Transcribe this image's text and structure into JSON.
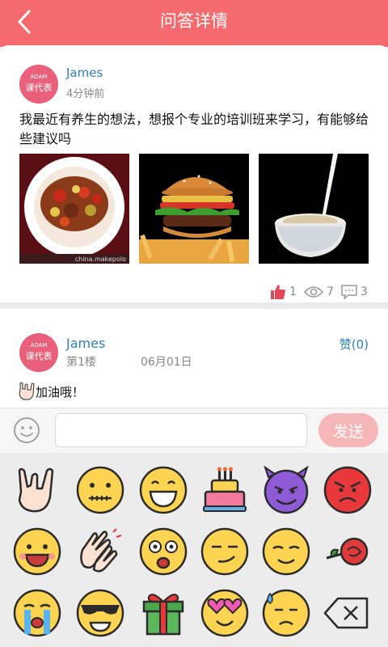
{
  "header": {
    "title": "问答详情",
    "back_icon": "back-arrow-icon"
  },
  "post": {
    "avatar_brand": "ADAM",
    "avatar_text": "课代表",
    "username": "James",
    "time": "4分钟前",
    "text": "我最近有养生的想法，想报个专业的培训班来学习，有能够给些建议吗",
    "photos": [
      "spicy-dish",
      "burger-and-fries",
      "milk-splash"
    ],
    "photo_watermark": "china.makepolo",
    "likes": "1",
    "views": "7",
    "comments": "3"
  },
  "reply": {
    "avatar_brand": "ADAM",
    "avatar_text": "课代表",
    "username": "James",
    "floor": "第1楼",
    "date": "06月01日",
    "like_label": "赞(0)",
    "text": "加油哦！"
  },
  "input": {
    "placeholder": "",
    "send_label": "发送"
  },
  "keyboard": {
    "emojis": [
      "rock-hand",
      "zipper-mouth",
      "grinning",
      "birthday-cake",
      "purple-devil",
      "angry-red",
      "laughing",
      "clapping-hands",
      "shocked",
      "smirk",
      "relieved-smile",
      "red-rose",
      "crying",
      "sunglasses",
      "gift-box",
      "heart-eyes",
      "sweat-face",
      "backspace"
    ]
  },
  "colors": {
    "brand": "#f56a6f",
    "link": "#2e7fc0",
    "send_disabled": "#f5b6b8"
  }
}
